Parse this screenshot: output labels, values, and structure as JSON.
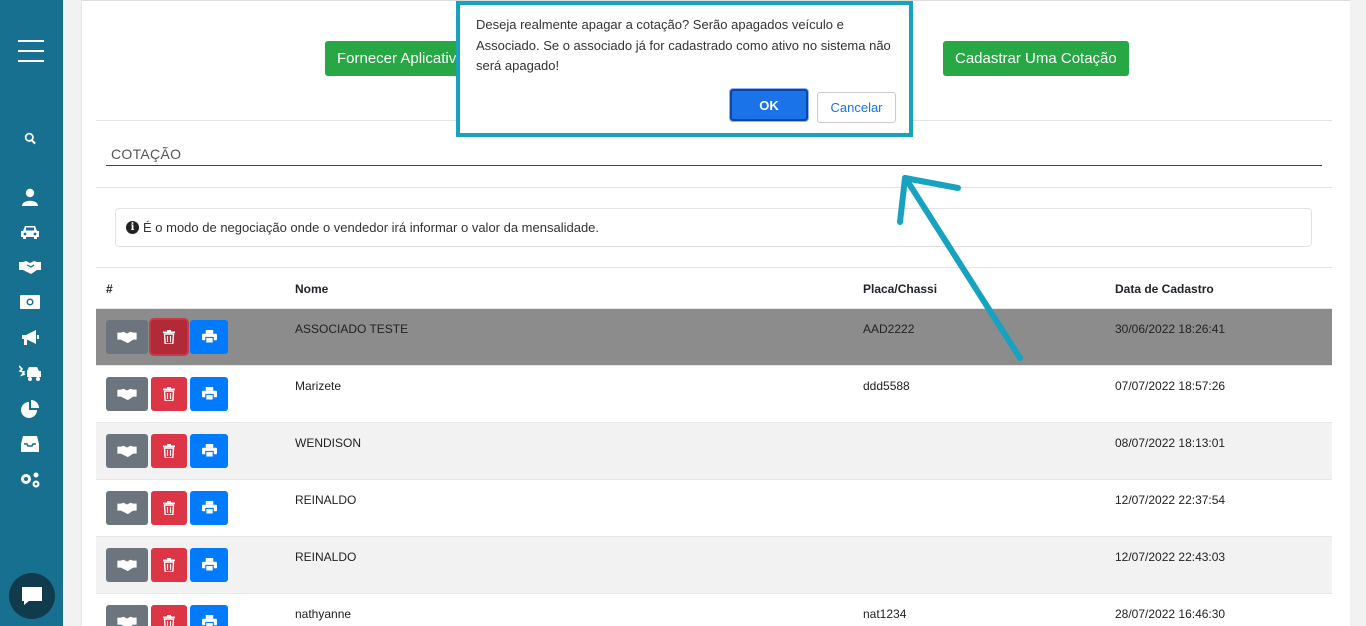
{
  "sidebar": {
    "menu_icon": "hamburger-icon",
    "items": [
      {
        "icon": "search-icon"
      },
      {
        "icon": "user-icon"
      },
      {
        "icon": "car-icon"
      },
      {
        "icon": "handshake-icon"
      },
      {
        "icon": "money-icon"
      },
      {
        "icon": "megaphone-icon"
      },
      {
        "icon": "car-crash-icon"
      },
      {
        "icon": "pie-chart-icon"
      },
      {
        "icon": "inbox-icon"
      },
      {
        "icon": "cogs-icon"
      }
    ],
    "chat_icon": "chat-icon"
  },
  "toolbar": {
    "fornecer_label": "Fornecer Aplicativo",
    "cadastrar_label": "Cadastrar Uma Cotação"
  },
  "section": {
    "title": "COTAÇÃO",
    "info_text": "É o modo de negociação onde o vendedor irá informar o valor da mensalidade."
  },
  "table": {
    "columns": [
      "#",
      "Nome",
      "Placa/Chassi",
      "Data de Cadastro"
    ],
    "rows": [
      {
        "nome": "ASSOCIADO TESTE",
        "placa": "AAD2222",
        "data": "30/06/2022 18:26:41"
      },
      {
        "nome": "Marizete",
        "placa": "ddd5588",
        "data": "07/07/2022 18:57:26"
      },
      {
        "nome": "WENDISON",
        "placa": "",
        "data": "08/07/2022 18:13:01"
      },
      {
        "nome": "REINALDO",
        "placa": "",
        "data": "12/07/2022 22:37:54"
      },
      {
        "nome": "REINALDO",
        "placa": "",
        "data": "12/07/2022 22:43:03"
      },
      {
        "nome": "nathyanne",
        "placa": "nat1234",
        "data": "28/07/2022 16:46:30"
      }
    ]
  },
  "dialog": {
    "message": "Deseja realmente apagar a cotação? Serão apagados veículo e Associado. Se o associado já for cadastrado como ativo no sistema não será apagado!",
    "ok_label": "OK",
    "cancel_label": "Cancelar"
  },
  "colors": {
    "sidebar": "#17708f",
    "green": "#28a745",
    "red": "#dc3545",
    "blue": "#007bff",
    "gray": "#6c757d",
    "annotation": "#17a2c0"
  }
}
